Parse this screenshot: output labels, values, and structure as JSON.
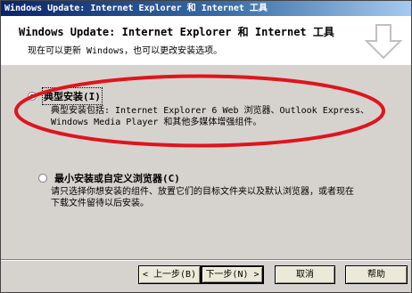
{
  "window": {
    "title": "Windows Update: Internet Explorer 和 Internet 工具"
  },
  "header": {
    "title": "Windows Update: Internet Explorer 和 Internet 工具",
    "subtitle": "现在可以更新 Windows，也可以更改安装选项。"
  },
  "options": [
    {
      "label": "典型安装(I)",
      "selected": true,
      "description_line1": "典型安装包括: Internet Explorer 6 Web 浏览器、Outlook Express、",
      "description_line2": "Windows Media Player 和其他多媒体增强组件。"
    },
    {
      "label": "最小安装或自定义浏览器(C)",
      "selected": false,
      "description_line1": "请只选择你想安装的组件、放置它们的目标文件夹以及默认浏览器，或者现在",
      "description_line2": "下载文件留待以后安装。"
    }
  ],
  "buttons": {
    "back": "< 上一步(B)",
    "next": "下一步(N) >",
    "cancel": "取消",
    "help": "帮助"
  },
  "colors": {
    "annotation_ellipse": "#e0141e",
    "title_bar_start": "#0a246a",
    "title_bar_end": "#a6caf0",
    "header_background": "#ffffff",
    "dialog_background": "#d6d3ce"
  },
  "icons": {
    "header_icon": "down-arrow-icon"
  }
}
